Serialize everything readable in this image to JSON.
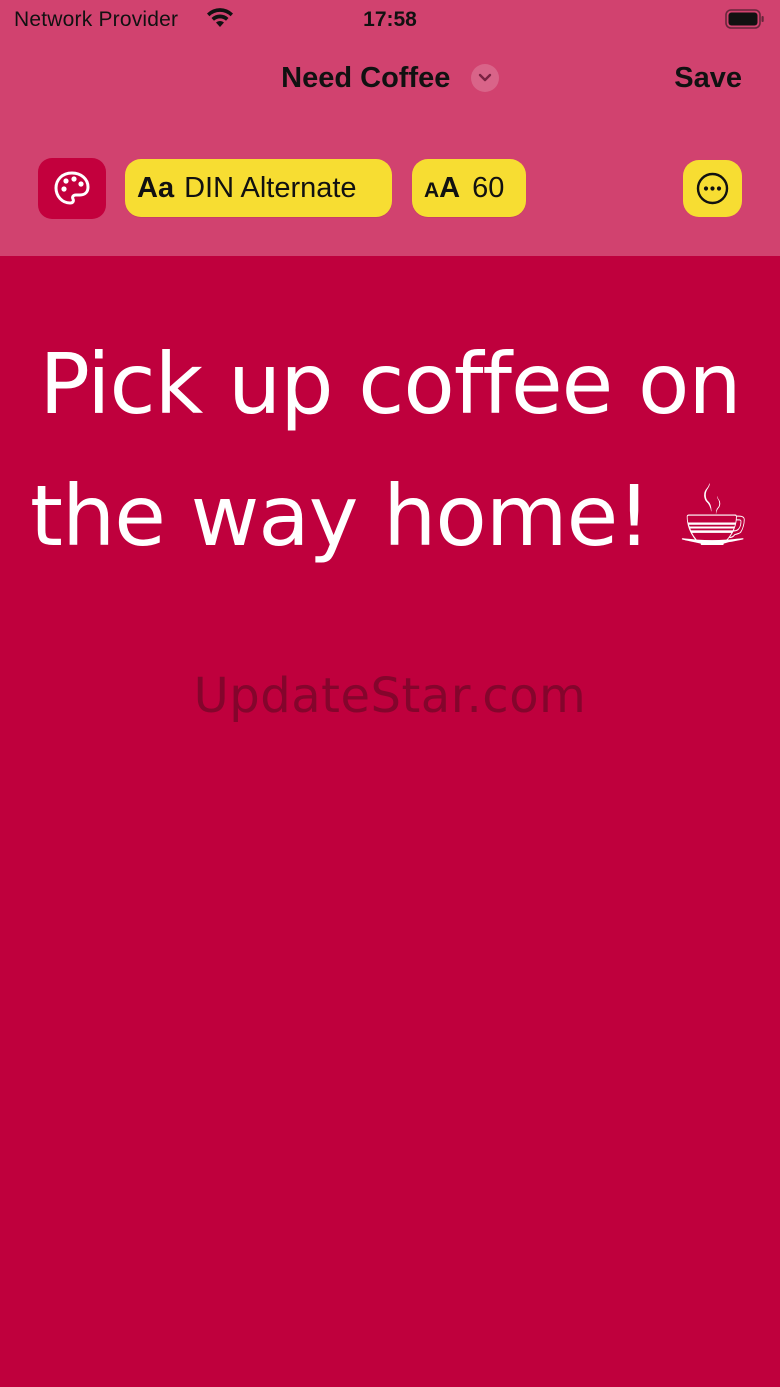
{
  "status_bar": {
    "carrier": "Network Provider",
    "time": "17:58",
    "wifi_icon": "wifi-icon",
    "battery_icon": "battery-icon"
  },
  "nav": {
    "title": "Need Coffee",
    "chevron_icon": "chevron-down-icon",
    "save_label": "Save"
  },
  "toolbar": {
    "palette_icon": "palette-icon",
    "font_glyph": "Aa",
    "font_name": "DIN Alternate",
    "size_glyph_small": "A",
    "size_glyph_large": "A",
    "font_size": "60",
    "more_icon": "ellipsis-circle-icon"
  },
  "note": {
    "text": "Pick up coffee on the way home! ☕"
  },
  "watermark": "UpdateStar.com",
  "colors": {
    "background": "#bf003d",
    "top_panel": "#d1426f",
    "pill": "#f7dd32",
    "palette_button": "#c3003d",
    "text": "#ffffff"
  }
}
